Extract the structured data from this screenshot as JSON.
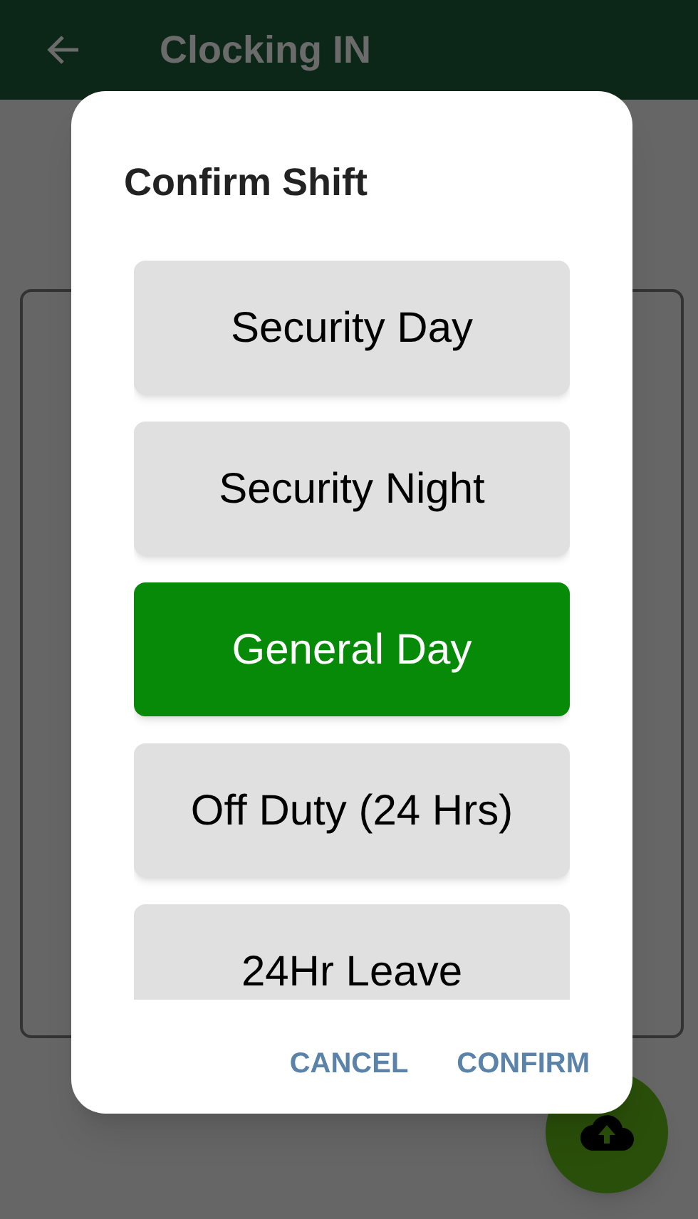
{
  "app_bar": {
    "title": "Clocking IN"
  },
  "dialog": {
    "title": "Confirm Shift",
    "options": [
      {
        "label": "Security Day",
        "selected": false
      },
      {
        "label": "Security Night",
        "selected": false
      },
      {
        "label": "General Day",
        "selected": true
      },
      {
        "label": "Off Duty (24 Hrs)",
        "selected": false
      },
      {
        "label": "24Hr Leave",
        "selected": false
      }
    ],
    "buttons": [
      "CANCEL",
      "CONFIRM"
    ]
  }
}
